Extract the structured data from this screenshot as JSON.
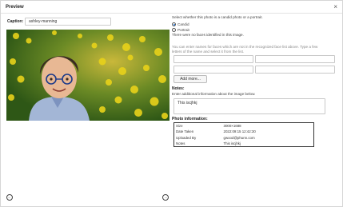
{
  "dialog": {
    "title": "Preview",
    "close_glyph": "×"
  },
  "caption": {
    "label": "Caption:",
    "value": "ashley-manning"
  },
  "photo": {
    "subject": "child-with-glasses-in-flower-field"
  },
  "classify": {
    "prompt": "Select whether this photo is a candid photo or a portrait.",
    "options": [
      "Candid",
      "Portrait"
    ],
    "selected": "Candid",
    "no_faces": "There were no faces identified in this image."
  },
  "faces": {
    "instructions_line1": "You can enter names for faces which are not in the recognized face list above. Type a few",
    "instructions_line2": "letters of the name and select it from the list.",
    "inputs": [
      "",
      "",
      "",
      ""
    ],
    "add_more_label": "Add more..."
  },
  "notes": {
    "label": "Notes:",
    "hint": "Enter additional information about the image below.",
    "value": "This iscjhkj"
  },
  "info": {
    "label": "Photo information:",
    "rows": [
      {
        "key": "Size",
        "value": "3000×1688"
      },
      {
        "key": "Date Taken",
        "value": "2022:09:15 12:42:30"
      },
      {
        "key": "Uploaded By",
        "value": "gwood@phunn.com"
      },
      {
        "key": "Notes",
        "value": "This iscjhkj"
      }
    ]
  },
  "nav": {
    "prev_glyph": "←",
    "next_glyph": "→"
  }
}
